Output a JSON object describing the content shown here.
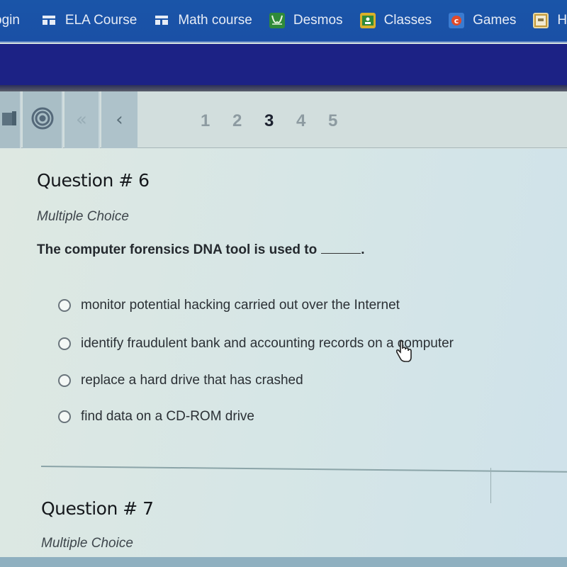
{
  "bookmarks": {
    "items": [
      {
        "label": "ogin",
        "icon": "none"
      },
      {
        "label": "ELA Course",
        "icon": "grid-icon"
      },
      {
        "label": "Math course",
        "icon": "grid-icon"
      },
      {
        "label": "Desmos",
        "icon": "desmos-icon"
      },
      {
        "label": "Classes",
        "icon": "classroom-icon"
      },
      {
        "label": "Games",
        "icon": "games-icon"
      },
      {
        "label": "Ho",
        "icon": "home-icon"
      }
    ]
  },
  "toolbar": {
    "first_glyph": "«",
    "prev_glyph": "‹",
    "pages": [
      "1",
      "2",
      "3",
      "4",
      "5"
    ],
    "current_page": "3"
  },
  "questions": [
    {
      "title": "Question # 6",
      "type": "Multiple Choice",
      "stem": "The computer forensics DNA tool is used to",
      "stem_end": ".",
      "options": [
        "monitor potential hacking carried out over the Internet",
        "identify fraudulent bank and accounting records on a computer",
        "replace a hard drive that has crashed",
        "find data on a CD-ROM drive"
      ]
    },
    {
      "title": "Question # 7",
      "type": "Multiple Choice"
    }
  ],
  "colors": {
    "bookmarks_bar": "#1a55a8",
    "banner": "#1c2285",
    "toolbar_button": "#a9bec6",
    "current_page": "#1d2230"
  }
}
